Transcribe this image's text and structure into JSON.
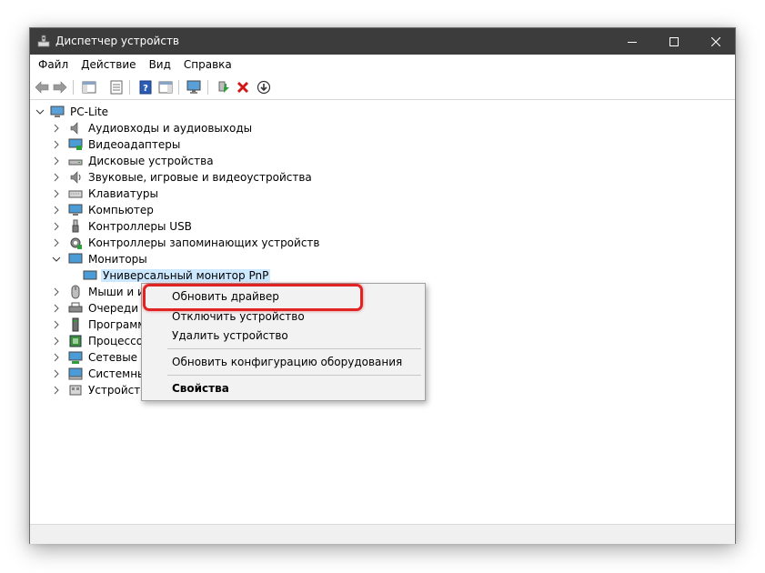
{
  "window": {
    "title": "Диспетчер устройств"
  },
  "menu": [
    "Файл",
    "Действие",
    "Вид",
    "Справка"
  ],
  "toolbar": {
    "icons": [
      "back-arrow-icon",
      "forward-arrow-icon",
      "show-hide-tree-icon",
      "properties-icon",
      "help-icon",
      "action-pane-icon",
      "monitor-scan-icon",
      "update-driver-icon",
      "uninstall-x-icon",
      "download-driver-icon"
    ]
  },
  "tree": {
    "root": "PC-Lite",
    "categories": [
      {
        "label": "Аудиовходы и аудиовыходы",
        "icon": "speaker-icon",
        "expanded": false
      },
      {
        "label": "Видеоадаптеры",
        "icon": "display-adapter-icon",
        "expanded": false
      },
      {
        "label": "Дисковые устройства",
        "icon": "disk-drive-icon",
        "expanded": false
      },
      {
        "label": "Звуковые, игровые и видеоустройства",
        "icon": "sound-device-icon",
        "expanded": false
      },
      {
        "label": "Клавиатуры",
        "icon": "keyboard-icon",
        "expanded": false
      },
      {
        "label": "Компьютер",
        "icon": "computer-icon",
        "expanded": false
      },
      {
        "label": "Контроллеры USB",
        "icon": "usb-icon",
        "expanded": false
      },
      {
        "label": "Контроллеры запоминающих устройств",
        "icon": "storage-controller-icon",
        "expanded": false
      },
      {
        "label": "Мониторы",
        "icon": "monitor-icon",
        "expanded": true,
        "children": [
          "Универсальный монитор PnP"
        ]
      },
      {
        "label": "Мыши и и",
        "icon": "mouse-icon",
        "expanded": false
      },
      {
        "label": "Очереди п",
        "icon": "print-queue-icon",
        "expanded": false
      },
      {
        "label": "Программ",
        "icon": "software-device-icon",
        "expanded": false
      },
      {
        "label": "Процессор",
        "icon": "processor-icon",
        "expanded": false
      },
      {
        "label": "Сетевые ад",
        "icon": "network-adapter-icon",
        "expanded": false
      },
      {
        "label": "Системны",
        "icon": "system-device-icon",
        "expanded": false
      },
      {
        "label": "Устройства",
        "icon": "hid-device-icon",
        "expanded": false
      }
    ]
  },
  "context_menu": {
    "items": [
      {
        "label": "Обновить драйвер",
        "bold": false,
        "highlighted": true
      },
      {
        "label": "Отключить устройство",
        "bold": false
      },
      {
        "label": "Удалить устройство",
        "bold": false
      },
      {
        "label": "Обновить конфигурацию оборудования",
        "bold": false
      },
      {
        "label": "Свойства",
        "bold": true
      }
    ]
  },
  "colors": {
    "titlebar": "#3c3c3c",
    "selection": "#cce8ff",
    "highlight_ring": "#e02424"
  }
}
